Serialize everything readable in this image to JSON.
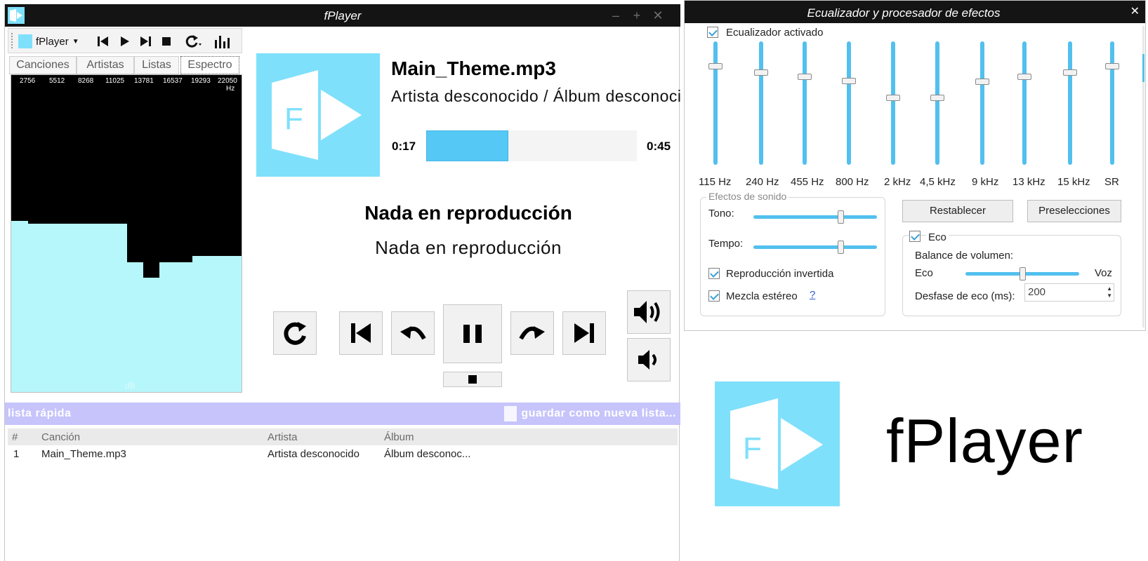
{
  "player": {
    "title": "fPlayer",
    "menu_label": "fPlayer",
    "tabs": [
      "Canciones",
      "Artistas",
      "Listas",
      "Espectro"
    ],
    "active_tab": "Espectro",
    "spectrum": {
      "freq_labels": [
        "2756",
        "5512",
        "8268",
        "11025",
        "13781",
        "16537",
        "19293",
        "22050"
      ],
      "freq_unit": "Hz",
      "db_label": "dB",
      "levels": [
        0.54,
        0.53,
        0.53,
        0.53,
        0.53,
        0.53,
        0.53,
        0.41,
        0.36,
        0.41,
        0.41,
        0.43,
        0.43,
        0.43
      ],
      "color": "#b6f7fb"
    },
    "track": {
      "title": "Main_Theme.mp3",
      "artist_album": "Artista desconocido / Álbum desconocido",
      "time_elapsed": "0:17",
      "time_total": "0:45",
      "progress": 0.39
    },
    "now_playing_title": "Nada en reproducción",
    "now_playing_subtitle": "Nada en reproducción",
    "accent_color": "#56c8f5",
    "quick_list": {
      "title": "lista rápida",
      "save_label": "guardar como nueva lista...",
      "columns": [
        "#",
        "Canción",
        "Artista",
        "Álbum"
      ],
      "rows": [
        [
          "1",
          "Main_Theme.mp3",
          "Artista desconocido",
          "Álbum desconoc..."
        ]
      ]
    }
  },
  "equalizer": {
    "title": "Ecualizador y procesador de efectos",
    "enabled_label": "Ecualizador activado",
    "bands": [
      {
        "label": "115 Hz",
        "level": 0.82
      },
      {
        "label": "240 Hz",
        "level": 0.77
      },
      {
        "label": "455 Hz",
        "level": 0.73
      },
      {
        "label": "800 Hz",
        "level": 0.7
      },
      {
        "label": "2 kHz",
        "level": 0.56
      },
      {
        "label": "4,5 kHz",
        "level": 0.56
      },
      {
        "label": "9 kHz",
        "level": 0.69
      },
      {
        "label": "13 kHz",
        "level": 0.73
      },
      {
        "label": "15 kHz",
        "level": 0.77
      },
      {
        "label": "SR",
        "level": 0.82
      }
    ],
    "effects": {
      "legend": "Efectos de sonido",
      "tono_label": "Tono:",
      "tono_value": 0.72,
      "tempo_label": "Tempo:",
      "tempo_value": 0.72,
      "reverse_label": "Reproducción invertida",
      "stereo_label": "Mezcla estéreo",
      "help_label": "?"
    },
    "reset_label": "Restablecer",
    "presets_label": "Preselecciones",
    "echo": {
      "label": "Eco",
      "balance_label": "Balance de volumen:",
      "left_label": "Eco",
      "right_label": "Voz",
      "balance_value": 0.5,
      "delay_label": "Desfase de eco (ms):",
      "delay_value": "200"
    }
  },
  "logo": {
    "text": "fPlayer"
  }
}
